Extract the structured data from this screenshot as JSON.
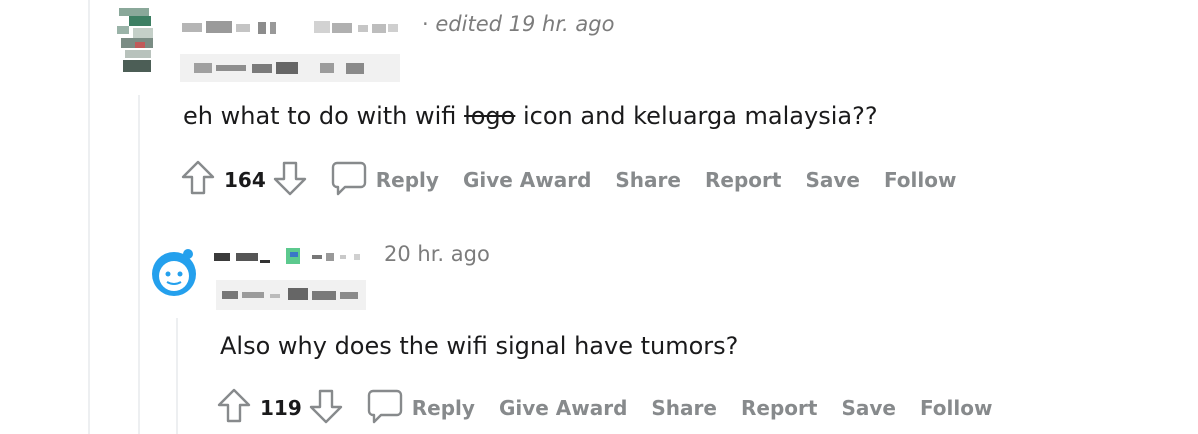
{
  "comments": [
    {
      "username": "",
      "separator": "·",
      "edited": "edited 19 hr. ago",
      "body_before": "eh what to do with wifi ",
      "body_strike": "logo",
      "body_after": " icon and keluarga malaysia??",
      "score": "164",
      "actions": {
        "reply": "Reply",
        "give_award": "Give Award",
        "share": "Share",
        "report": "Report",
        "save": "Save",
        "follow": "Follow"
      }
    },
    {
      "username": "",
      "time": "20 hr. ago",
      "body": "Also why does the wifi signal have tumors?",
      "score": "119",
      "actions": {
        "reply": "Reply",
        "give_award": "Give Award",
        "share": "Share",
        "report": "Report",
        "save": "Save",
        "follow": "Follow"
      }
    }
  ],
  "icons": [
    "upvote-icon",
    "downvote-icon",
    "comment-icon",
    "avatar-icon"
  ],
  "colors": {
    "text": "#1a1a1b",
    "muted": "#878a8c",
    "line": "#edeff1"
  }
}
